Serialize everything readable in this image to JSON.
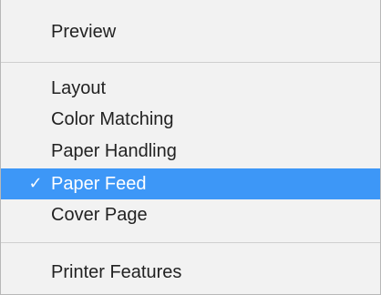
{
  "menu": {
    "preview": "Preview",
    "layout": "Layout",
    "color_matching": "Color Matching",
    "paper_handling": "Paper Handling",
    "paper_feed": "Paper Feed",
    "cover_page": "Cover Page",
    "printer_features": "Printer Features",
    "selected_mark": "✓",
    "selected_color": "#3d97f7"
  }
}
